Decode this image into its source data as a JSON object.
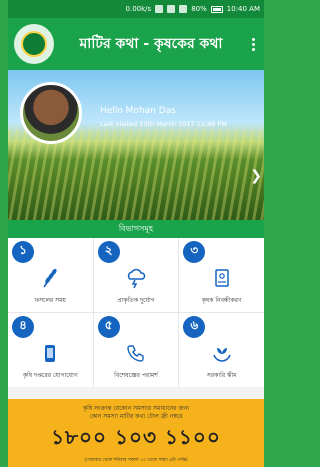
{
  "status_bar": {
    "network": "0.00k/s",
    "battery_percent": "80%",
    "time": "10:40 AM"
  },
  "app": {
    "title": "মাটির কথা - কৃষকের কথা"
  },
  "hero": {
    "greeting": "Hello Mohan Das",
    "last_visited": "Last visited 13th March 2017 11:46 PM"
  },
  "services": {
    "heading": "বিভাগসমূহ",
    "items": [
      {
        "num": "১",
        "label": "ফসলের সময়"
      },
      {
        "num": "২",
        "label": "প্রাকৃতিক দুর্যোগ"
      },
      {
        "num": "৩",
        "label": "কৃষক নিবন্ধীকরণ"
      },
      {
        "num": "৪",
        "label": "কৃষি দপ্তরের যোগাযোগ"
      },
      {
        "num": "৫",
        "label": "বিশেষজ্ঞের পরামর্শ"
      },
      {
        "num": "৬",
        "label": "সরকারি স্কীম"
      }
    ]
  },
  "footer": {
    "line1": "কৃষি সংক্রান্ত যেকোন সমস্যার সমাধানের জন্য",
    "line2": "কোন সমস্যা মাটির কথা টোল ফ্রী নম্বরে",
    "phone": "১৮০০ ১০৩ ১১০০",
    "line3": "(সোমবার থেকে শনিবার সকাল ১০ থেকে সন্ধ্যা ৬টা পর্যন্ত)"
  },
  "colors": {
    "brand": "#1aa34a",
    "num_badge": "#1565c0",
    "footer": "#f6b21a"
  }
}
